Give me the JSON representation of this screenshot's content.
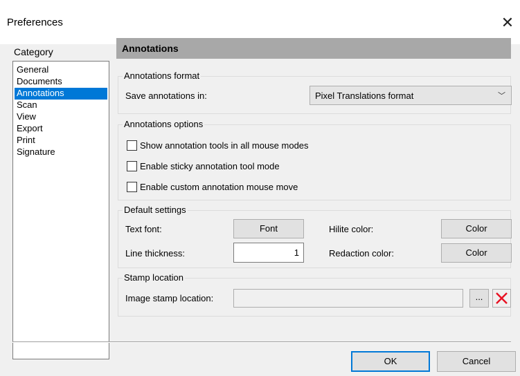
{
  "window": {
    "title": "Preferences",
    "close_glyph": "✕"
  },
  "category": {
    "label": "Category",
    "items": [
      "General",
      "Documents",
      "Annotations",
      "Scan",
      "View",
      "Export",
      "Print",
      "Signature"
    ],
    "selected": "Annotations"
  },
  "panel": {
    "header": "Annotations"
  },
  "format": {
    "group_title": "Annotations format",
    "save_label": "Save annotations in:",
    "save_value": "Pixel Translations format"
  },
  "options": {
    "group_title": "Annotations options",
    "checkboxes": [
      {
        "label": "Show annotation tools in all mouse modes",
        "checked": false
      },
      {
        "label": "Enable sticky annotation tool mode",
        "checked": false
      },
      {
        "label": "Enable custom annotation mouse move",
        "checked": false
      }
    ]
  },
  "defaults": {
    "group_title": "Default settings",
    "text_font_label": "Text font:",
    "font_button": "Font",
    "hilite_label": "Hilite color:",
    "hilite_button": "Color",
    "line_thickness_label": "Line thickness:",
    "line_thickness_value": "1",
    "redaction_label": "Redaction color:",
    "redaction_button": "Color"
  },
  "stamp": {
    "group_title": "Stamp location",
    "image_label": "Image stamp location:",
    "image_value": "",
    "browse_button": "...",
    "clear_icon": "red-x-icon",
    "clear_color": "#e81123"
  },
  "footer": {
    "ok": "OK",
    "cancel": "Cancel"
  }
}
